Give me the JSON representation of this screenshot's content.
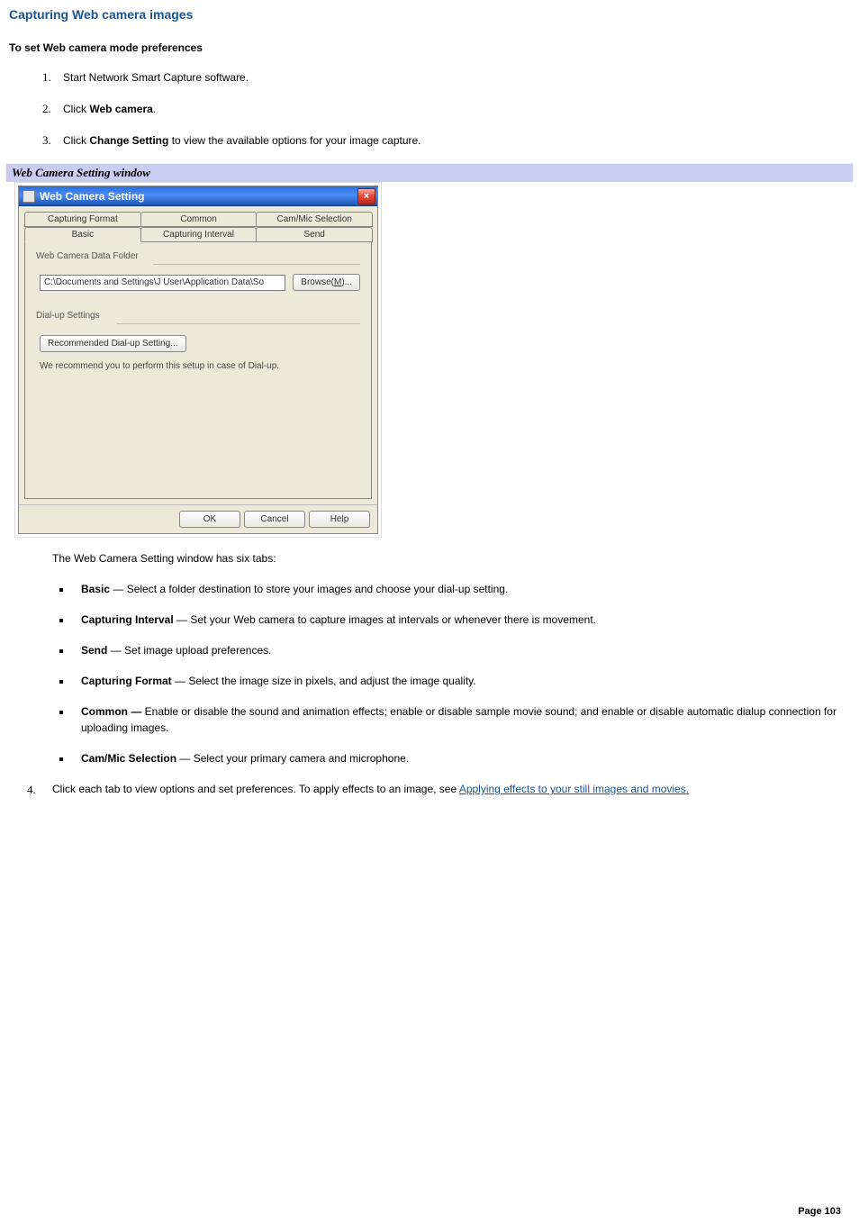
{
  "page_title": "Capturing Web camera images",
  "subsection_title": "To set Web camera mode preferences",
  "steps": {
    "s1": "Start Network Smart Capture software.",
    "s2_pre": "Click ",
    "s2_bold": "Web camera",
    "s2_post": ".",
    "s3_pre": "Click ",
    "s3_bold": "Change Setting",
    "s3_post": " to view the available options for your image capture."
  },
  "caption": "Web Camera Setting window",
  "dialog": {
    "title": "Web Camera Setting",
    "close_x": "×",
    "tabs_row1": [
      "Capturing Format",
      "Common",
      "Cam/Mic Selection"
    ],
    "tabs_row2": [
      "Basic",
      "Capturing Interval",
      "Send"
    ],
    "group_folder": "Web Camera Data Folder",
    "folder_path": "C:\\Documents and Settings\\J User\\Application Data\\So",
    "browse_label": "Browse(M)...",
    "group_dialup": "Dial-up Settings",
    "dialup_btn": "Recommended Dial-up Setting...",
    "dialup_note": "We recommend you to perform this setup in case of Dial-up.",
    "ok": "OK",
    "cancel": "Cancel",
    "help": "Help"
  },
  "tabs_intro": "The Web Camera Setting window has six tabs:",
  "tab_desc": {
    "basic_b": "Basic",
    "basic_t": " — Select a folder destination to store your images and choose your dial-up setting.",
    "ci_b": "Capturing Interval",
    "ci_t": " — Set your Web camera to capture images at intervals or whenever there is movement.",
    "send_b": "Send",
    "send_t": " — Set image upload preferences.",
    "cf_b": "Capturing Format",
    "cf_t": " — Select the image size in pixels, and adjust the image quality.",
    "common_b": "Common — ",
    "common_t": "Enable or disable the sound and animation effects; enable or disable sample movie sound; and enable or disable automatic dialup connection for uploading images.",
    "cm_b": "Cam/Mic Selection",
    "cm_t": " — Select your primary camera and microphone."
  },
  "step4_num": "4.",
  "step4_pre": "Click each tab to view options and set preferences. To apply effects to an image, see ",
  "step4_link": "Applying effects to your still images and movies.",
  "footer": "Page 103"
}
